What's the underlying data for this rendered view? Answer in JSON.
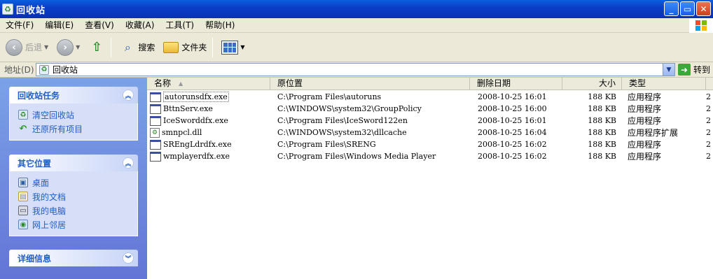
{
  "window": {
    "title": "回收站",
    "controls": {
      "minimize": "_",
      "maximize": "▭",
      "close": "✕"
    }
  },
  "menu": [
    {
      "label": "文件(F)"
    },
    {
      "label": "编辑(E)"
    },
    {
      "label": "查看(V)"
    },
    {
      "label": "收藏(A)"
    },
    {
      "label": "工具(T)"
    },
    {
      "label": "帮助(H)"
    }
  ],
  "toolbar": {
    "back_label": "后退",
    "search_label": "搜索",
    "folders_label": "文件夹"
  },
  "address": {
    "label": "地址(D)",
    "value": "回收站",
    "go_label": "转到"
  },
  "sidebar": {
    "tasks": {
      "title": "回收站任务",
      "items": [
        {
          "label": "清空回收站",
          "icon": "empty-bin-icon"
        },
        {
          "label": "还原所有项目",
          "icon": "restore-icon"
        }
      ]
    },
    "places": {
      "title": "其它位置",
      "items": [
        {
          "label": "桌面",
          "icon": "desktop-icon"
        },
        {
          "label": "我的文档",
          "icon": "documents-icon"
        },
        {
          "label": "我的电脑",
          "icon": "computer-icon"
        },
        {
          "label": "网上邻居",
          "icon": "network-icon"
        }
      ]
    },
    "details": {
      "title": "详细信息"
    }
  },
  "columns": {
    "name": "名称",
    "original": "原位置",
    "deleted": "删除日期",
    "size": "大小",
    "type": "类型"
  },
  "files": [
    {
      "name": "autorunsdfx.exe",
      "original": "C:\\Program Files\\autoruns",
      "deleted": "2008-10-25 16:01",
      "size": "188 KB",
      "type": "应用程序",
      "extra": "2",
      "icon": "exe-icon"
    },
    {
      "name": "BttnServ.exe",
      "original": "C:\\WINDOWS\\system32\\GroupPolicy",
      "deleted": "2008-10-25 16:00",
      "size": "188 KB",
      "type": "应用程序",
      "extra": "2",
      "icon": "exe-icon"
    },
    {
      "name": "IceSworddfx.exe",
      "original": "C:\\Program Files\\IceSword122en",
      "deleted": "2008-10-25 16:01",
      "size": "188 KB",
      "type": "应用程序",
      "extra": "2",
      "icon": "exe-icon"
    },
    {
      "name": "smnpcl.dll",
      "original": "C:\\WINDOWS\\system32\\dllcache",
      "deleted": "2008-10-25 16:04",
      "size": "188 KB",
      "type": "应用程序扩展",
      "extra": "2",
      "icon": "dll-icon"
    },
    {
      "name": "SREngLdrdfx.exe",
      "original": "C:\\Program Files\\SRENG",
      "deleted": "2008-10-25 16:02",
      "size": "188 KB",
      "type": "应用程序",
      "extra": "2",
      "icon": "exe-icon"
    },
    {
      "name": "wmplayerdfx.exe",
      "original": "C:\\Program Files\\Windows Media Player",
      "deleted": "2008-10-25 16:02",
      "size": "188 KB",
      "type": "应用程序",
      "extra": "2",
      "icon": "exe-icon"
    }
  ]
}
